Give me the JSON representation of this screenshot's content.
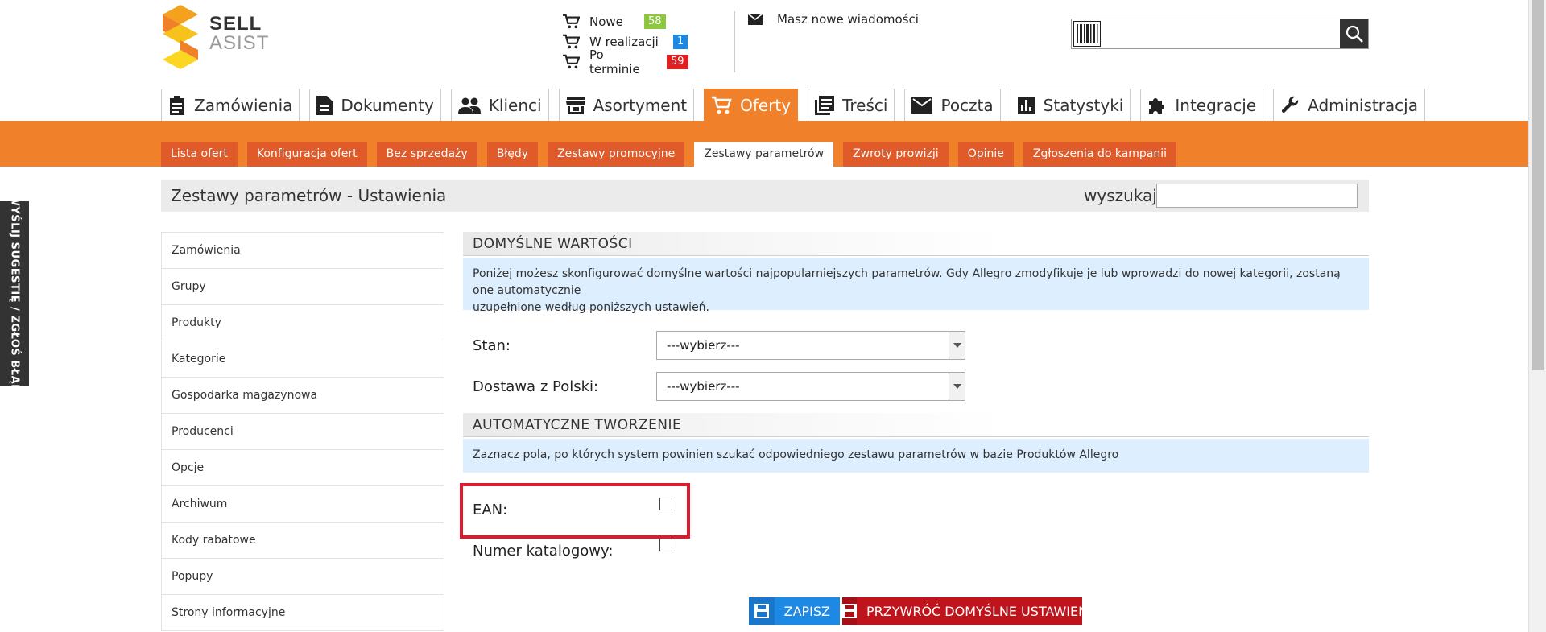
{
  "logo": {
    "line1": "SELL",
    "line2": "ASIST"
  },
  "header_status": [
    {
      "label": "Nowe",
      "count": "58",
      "color": "#8dc63f"
    },
    {
      "label": "W realizacji",
      "count": "1",
      "color": "#1e88e5"
    },
    {
      "label": "Po terminie",
      "count": "59",
      "color": "#e02020"
    }
  ],
  "messages": {
    "text": "Masz nowe wiadomości"
  },
  "search": {
    "value": ""
  },
  "main_nav": {
    "active": "Oferty",
    "tabs": [
      "Zamówienia",
      "Dokumenty",
      "Klienci",
      "Asortyment",
      "Oferty",
      "Treści",
      "Poczta",
      "Statystyki",
      "Integracje",
      "Administracja"
    ]
  },
  "sub_nav": {
    "active": "Zestawy parametrów",
    "tabs": [
      "Lista ofert",
      "Konfiguracja ofert",
      "Bez sprzedaży",
      "Błędy",
      "Zestawy promocyjne",
      "Zestawy parametrów",
      "Zwroty prowizji",
      "Opinie",
      "Zgłoszenia do kampanii"
    ]
  },
  "feedback_tab": "WYŚLIJ SUGESTIĘ / ZGŁOŚ BŁĄD",
  "page": {
    "title": "Zestawy parametrów - Ustawienia",
    "find_label": "wyszukaj:",
    "find_value": ""
  },
  "side_menu": [
    "Zamówienia",
    "Grupy",
    "Produkty",
    "Kategorie",
    "Gospodarka magazynowa",
    "Producenci",
    "Opcje",
    "Archiwum",
    "Kody rabatowe",
    "Popupy",
    "Strony informacyjne"
  ],
  "defaults_section": {
    "heading": "DOMYŚLNE WARTOŚCI",
    "info_line1": "Poniżej możesz skonfigurować domyślne wartości najpopularniejszych parametrów. Gdy Allegro zmodyfikuje je lub wprowadzi do nowej kategorii, zostaną one automatycznie",
    "info_line2": "uzupełnione według poniższych ustawień.",
    "fields": [
      {
        "label": "Stan:",
        "value": "---wybierz---"
      },
      {
        "label": "Dostawa z Polski:",
        "value": "---wybierz---"
      }
    ]
  },
  "auto_section": {
    "heading": "AUTOMATYCZNE TWORZENIE",
    "info": "Zaznacz pola, po których system powinien szukać odpowiedniego zestawu parametrów w bazie Produktów Allegro",
    "checkboxes": [
      {
        "label": "EAN:",
        "checked": false
      },
      {
        "label": "Numer katalogowy:",
        "checked": false
      }
    ]
  },
  "buttons": {
    "save": "ZAPISZ",
    "restore": "PRZYWRÓĆ DOMYŚLNE USTAWIENIA"
  },
  "colors": {
    "accent": "#f0812a",
    "subtab": "#e05a2a",
    "save": "#1e88e5",
    "restore": "#c0141c",
    "highlight": "#e1192e"
  }
}
